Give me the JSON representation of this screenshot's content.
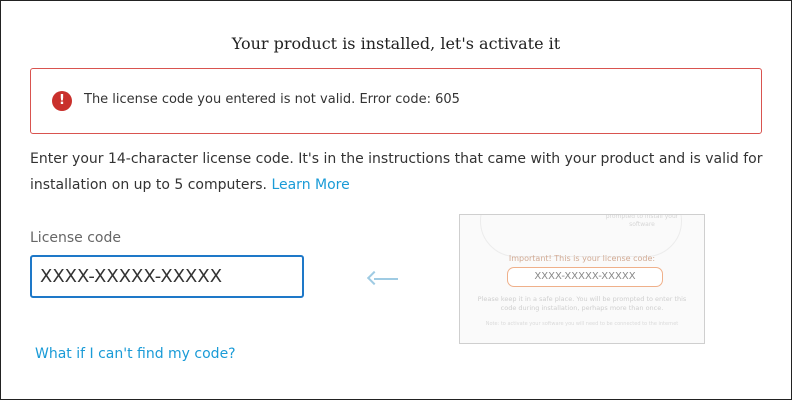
{
  "dialog": {
    "title": "Your product is installed, let's activate it"
  },
  "error": {
    "icon": "error-icon",
    "icon_glyph": "!",
    "color": "#d9534f",
    "message": "The license code you entered is not valid. Error code: 605"
  },
  "instructions": {
    "text": "Enter your 14-character license code. It's in the instructions that came with your product and is valid for installation on up to 5 computers. ",
    "link": "Learn More"
  },
  "license_field": {
    "label": "License code",
    "value": "XXXX-XXXXX-XXXXX"
  },
  "sample_card": {
    "faint_text": "prompted to install your software",
    "title": "Important! This is your license code:",
    "code": "XXXX-XXXXX-XXXXX",
    "note": "Please keep it in a safe place. You will be prompted to enter this code during installation, perhaps more than once.",
    "footnote": "Note: to activate your software you will need to be connected to the internet"
  },
  "help_link": "What if I can't find my code?",
  "colors": {
    "link": "#1a9bd7",
    "input_border": "#1e78c8",
    "error_border": "#d9534f"
  }
}
